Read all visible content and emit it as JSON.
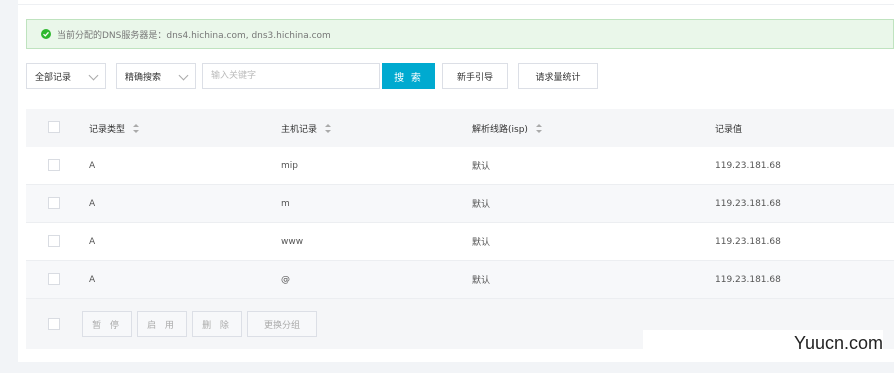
{
  "notice": {
    "text": "当前分配的DNS服务器是：dns4.hichina.com, dns3.hichina.com",
    "icon": "check-circle-icon",
    "color": "#2eb82e"
  },
  "toolbar": {
    "filter_select": "全部记录",
    "search_mode_select": "精确搜索",
    "keyword_placeholder": "输入关键字",
    "search_label": "搜 索",
    "guide_label": "新手引导",
    "stats_label": "请求量统计",
    "accent_color": "#00aad0"
  },
  "table": {
    "headers": {
      "type": "记录类型",
      "host": "主机记录",
      "line": "解析线路(isp)",
      "value": "记录值"
    },
    "rows": [
      {
        "type": "A",
        "host": "mip",
        "line": "默认",
        "value": "119.23.181.68"
      },
      {
        "type": "A",
        "host": "m",
        "line": "默认",
        "value": "119.23.181.68"
      },
      {
        "type": "A",
        "host": "www",
        "line": "默认",
        "value": "119.23.181.68"
      },
      {
        "type": "A",
        "host": "@",
        "line": "默认",
        "value": "119.23.181.68"
      }
    ]
  },
  "footer": {
    "pause_label": "暂 停",
    "enable_label": "启 用",
    "delete_label": "删 除",
    "change_group_label": "更换分组"
  },
  "watermark": "Yuucn.com"
}
